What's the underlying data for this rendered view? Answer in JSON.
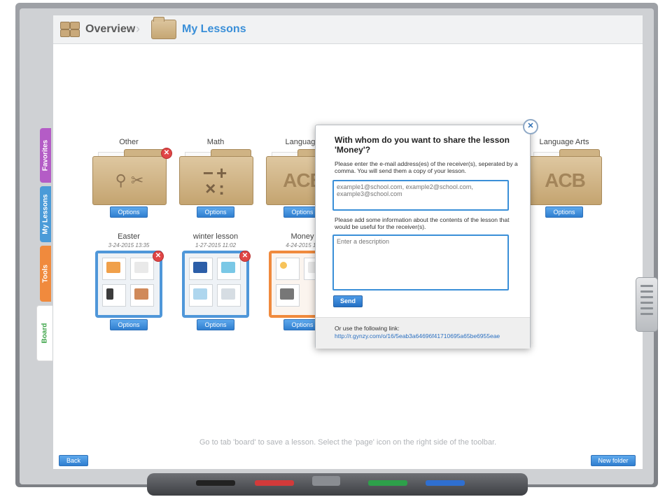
{
  "header": {
    "overview_label": "Overview",
    "separator": "›",
    "my_lessons_label": "My Lessons"
  },
  "side_tabs": {
    "favorites": "Favorites",
    "my_lessons": "My Lessons",
    "tools": "Tools",
    "board": "Board"
  },
  "folders": [
    {
      "title": "Other",
      "icon": "other-folder-icon",
      "options": "Options",
      "delete": "✕"
    },
    {
      "title": "Math",
      "icon": "math-folder-icon",
      "glyph": "−+×:",
      "options": "Options"
    },
    {
      "title": "Language",
      "icon": "language-folder-icon",
      "glyph": "ACB",
      "options": "Options"
    },
    {
      "title": "Language Arts",
      "icon": "language-arts-folder-icon",
      "glyph": "ACB",
      "options": "Options"
    }
  ],
  "lessons": [
    {
      "title": "Easter",
      "date": "3-24-2015 13:35",
      "options": "Options",
      "delete": "✕"
    },
    {
      "title": "winter lesson",
      "date": "1-27-2015 11:02",
      "options": "Options",
      "delete": "✕"
    },
    {
      "title": "Money",
      "date": "4-24-2015 12",
      "options": "Options"
    }
  ],
  "modal": {
    "close": "✕",
    "title": "With whom do you want to share the lesson 'Money'?",
    "email_instructions": "Please enter the e-mail address(es) of the receiver(s), seperated by a comma. You will send them a copy of your lesson.",
    "email_placeholder": "example1@school.com, example2@school.com, example3@school.com",
    "description_instructions": "Please add some information about the contents of the lesson that would be useful for the receiver(s).",
    "description_placeholder": "Enter a description",
    "send_label": "Send",
    "link_label": "Or use the following link:",
    "link_url": "http://r.gynzy.com/o/16/5eab3a64696f41710695a65be6955eae"
  },
  "footer": {
    "hint": "Go to tab 'board' to save a lesson. Select the 'page' icon on the right side of the toolbar.",
    "back_label": "Back",
    "new_folder_label": "New folder"
  },
  "colors": {
    "accent_blue": "#3a8fd8",
    "favorites_tab": "#b45cc6",
    "lessons_tab": "#4b9bd8",
    "tools_tab": "#f08a3d",
    "board_tab_text": "#3fa54a",
    "delete_red": "#e04646"
  }
}
